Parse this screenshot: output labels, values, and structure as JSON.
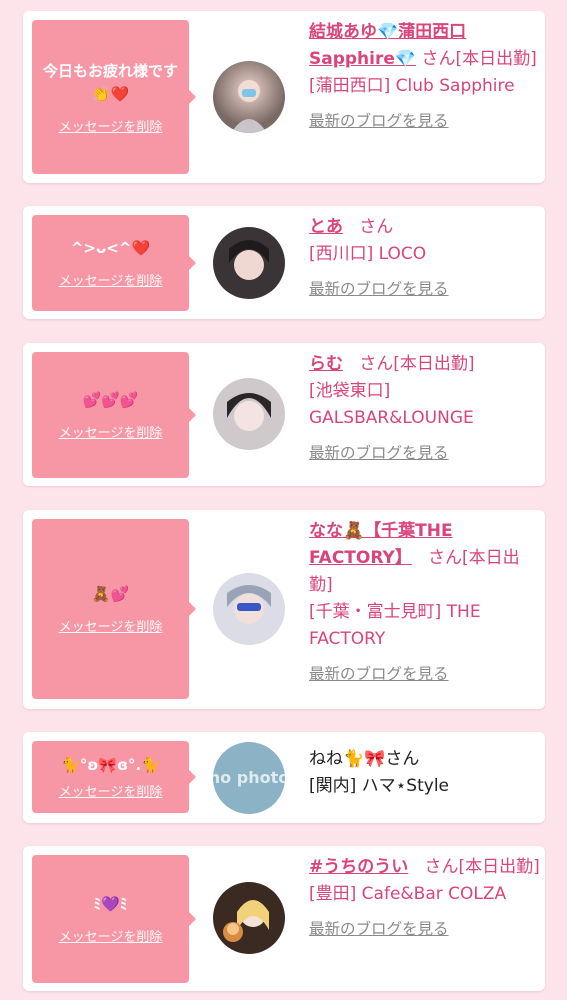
{
  "messages": [
    {
      "message": "今日もお疲れ様です👏❤️",
      "delete_label": "メッセージを削除",
      "name": "結城あゆ💎蒲田西口Sapphire💎",
      "san": "さん[本日出勤]",
      "shop": "[蒲田西口] Club Sapphire",
      "blog": "最新のブログを見る"
    },
    {
      "message": "^>ᴗ<^❤️",
      "delete_label": "メッセージを削除",
      "name": "とあ",
      "san": "さん",
      "shop": "[西川口] LOCO",
      "blog": "最新のブログを見る"
    },
    {
      "message": "💕💕💕",
      "delete_label": "メッセージを削除",
      "name": "らむ",
      "san": "さん[本日出勤]",
      "shop": "[池袋東口] GALSBAR&LOUNGE",
      "blog": "最新のブログを見る"
    },
    {
      "message": "🧸💕",
      "delete_label": "メッセージを削除",
      "name": "なな🧸【千葉THE FACTORY】",
      "san": "さん[本日出勤]",
      "shop": "[千葉・富士見町] THE FACTORY",
      "blog": "最新のブログを見る"
    },
    {
      "message": "🐈°ʚ🎀ɞ°.🐈",
      "delete_label": "メッセージを削除",
      "name": "ねね🐈🎀さん",
      "shop": "[関内] ハマ⋆Style",
      "avatar_text": "no photo"
    },
    {
      "message": "ﾐ💜ﾐ",
      "delete_label": "メッセージを削除",
      "name": "#うちのうい",
      "san": "さん[本日出勤]",
      "shop": "[豊田] Cafe&Bar COLZA",
      "blog": "最新のブログを見る"
    }
  ],
  "colors": {
    "accent": "#d9457b",
    "bubble": "#f797a6",
    "background": "#fde4ea"
  }
}
